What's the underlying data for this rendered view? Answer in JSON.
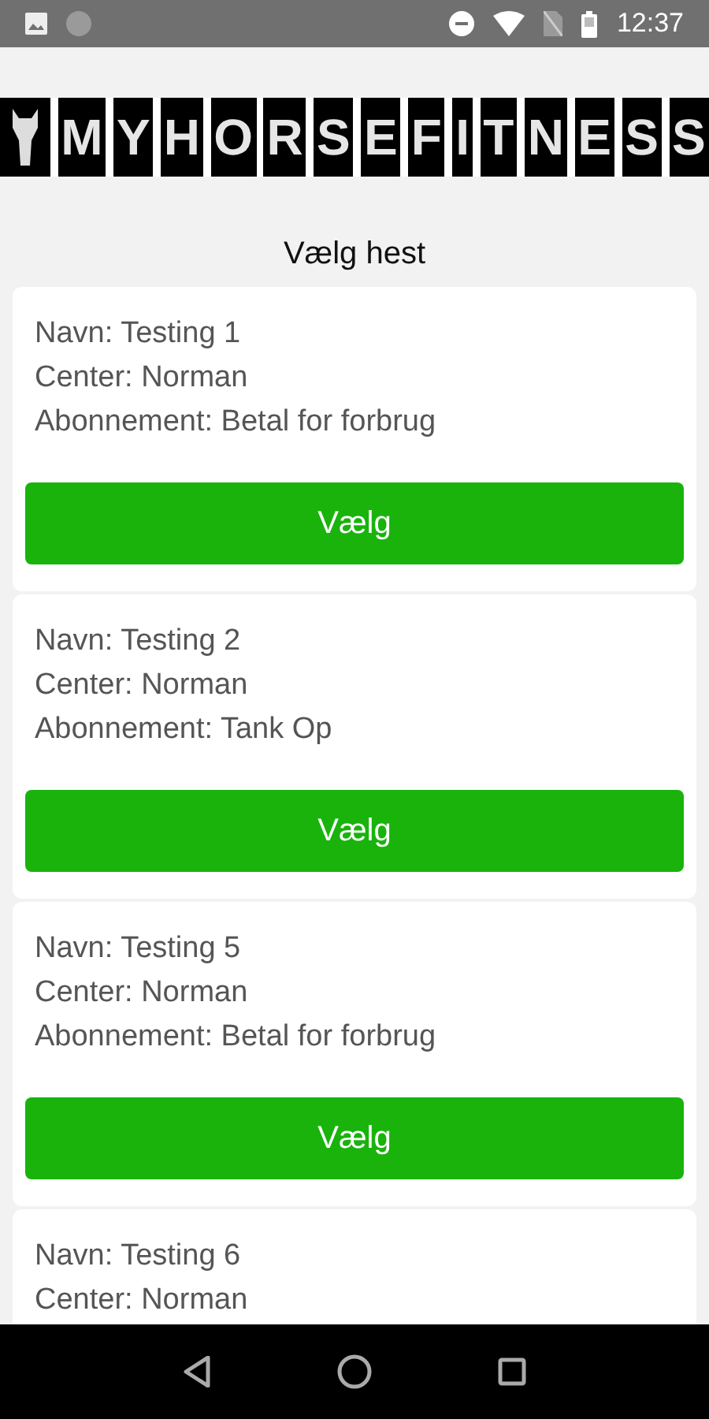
{
  "status_bar": {
    "time": "12:37"
  },
  "logo": {
    "text": "MYHORSEFITNESS"
  },
  "title": "Vælg hest",
  "horses": [
    {
      "name": "Navn: Testing 1",
      "center": "Center: Norman",
      "subscription": "Abonnement: Betal for forbrug",
      "button": "Vælg"
    },
    {
      "name": "Navn: Testing 2",
      "center": "Center: Norman",
      "subscription": "Abonnement: Tank Op",
      "button": "Vælg"
    },
    {
      "name": "Navn: Testing 5",
      "center": "Center: Norman",
      "subscription": "Abonnement: Betal for forbrug",
      "button": "Vælg"
    },
    {
      "name": "Navn: Testing 6",
      "center": "Center: Norman"
    }
  ]
}
